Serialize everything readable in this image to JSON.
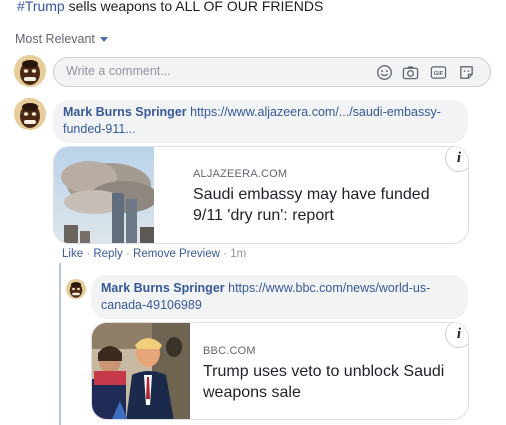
{
  "post": {
    "hashtag": "#Trump",
    "text": " sells weapons to ALL OF OUR FRIENDS"
  },
  "sort": {
    "label": "Most Relevant"
  },
  "composer": {
    "placeholder": "Write a comment..."
  },
  "composer_icons": [
    "emoji-icon",
    "camera-icon",
    "gif-icon",
    "sticker-icon"
  ],
  "comments": [
    {
      "author": "Mark Burns Springer",
      "link_text": "https://www.aljazeera.com/.../saudi-embassy-funded-911...",
      "preview": {
        "source": "ALJAZEERA.COM",
        "title": "Saudi embassy may have funded 9/11 'dry run': report"
      },
      "actions": {
        "like": "Like",
        "reply": "Reply",
        "remove_preview": "Remove Preview",
        "time": "1m"
      }
    },
    {
      "author": "Mark Burns Springer",
      "link_text": "https://www.bbc.com/news/world-us-canada-49106989",
      "preview": {
        "source": "BBC.COM",
        "title": "Trump uses veto to unblock Saudi weapons sale"
      }
    }
  ],
  "info_label": "i",
  "colors": {
    "link": "#385898",
    "bubble": "#f2f3f5",
    "meta": "#606770"
  }
}
